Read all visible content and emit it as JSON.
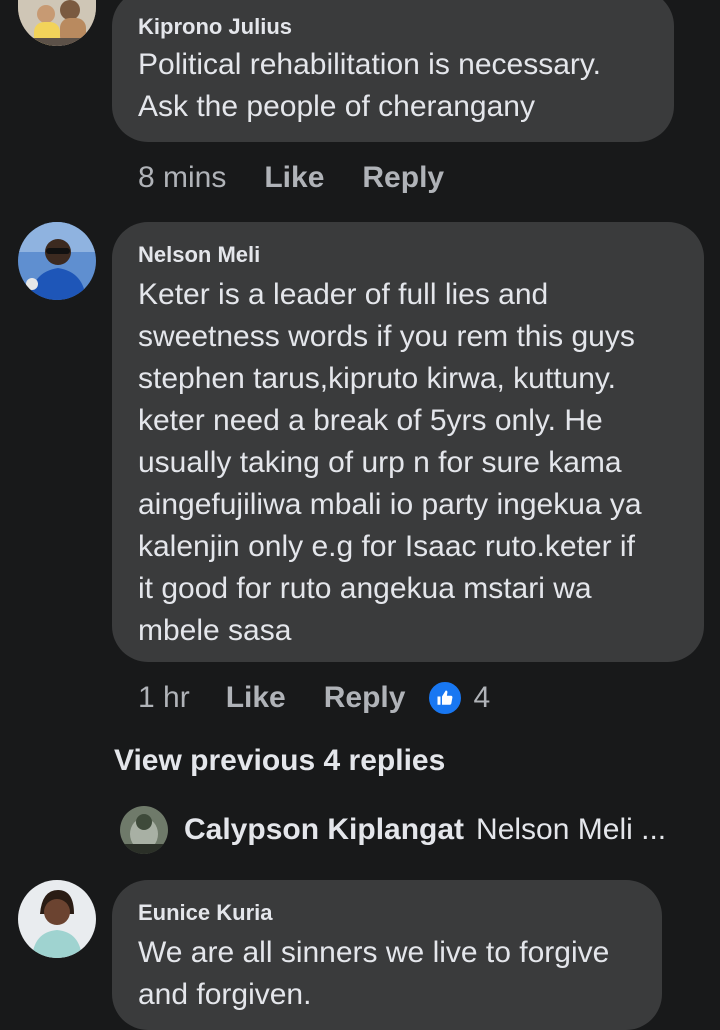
{
  "comments": [
    {
      "author": "Kiprono Julius",
      "lines": [
        "Political rehabilitation is necessary.",
        "Ask the people of cherangany"
      ],
      "time": "8 mins",
      "like_label": "Like",
      "reply_label": "Reply"
    },
    {
      "author": "Nelson Meli",
      "lines": [
        "Keter is a leader of full lies and",
        "sweetness words if you rem this guys",
        "stephen tarus,kipruto kirwa, kuttuny.",
        "keter need a break of 5yrs only. He",
        "usually taking of urp n for sure kama",
        "aingefujiliwa mbali io party ingekua ya",
        "kalenjin only e.g for Isaac ruto.keter if",
        "it good for ruto angekua mstari wa",
        "mbele sasa"
      ],
      "time": "1 hr",
      "like_label": "Like",
      "reply_label": "Reply",
      "reaction_count": "4"
    },
    {
      "author": "Eunice Kuria",
      "lines": [
        "We are all sinners we live to forgive",
        "and forgiven."
      ]
    }
  ],
  "view_previous": "View previous 4 replies",
  "reply_preview": {
    "author": "Calypson Kiplangat",
    "text": "Nelson Meli ..."
  },
  "colors": {
    "background": "#18191a",
    "bubble": "#3a3b3c",
    "text": "#e4e6eb",
    "muted": "#b0b3b8",
    "like_blue": "#1877f2"
  },
  "icons": {
    "reaction": "thumbs-up-icon"
  }
}
